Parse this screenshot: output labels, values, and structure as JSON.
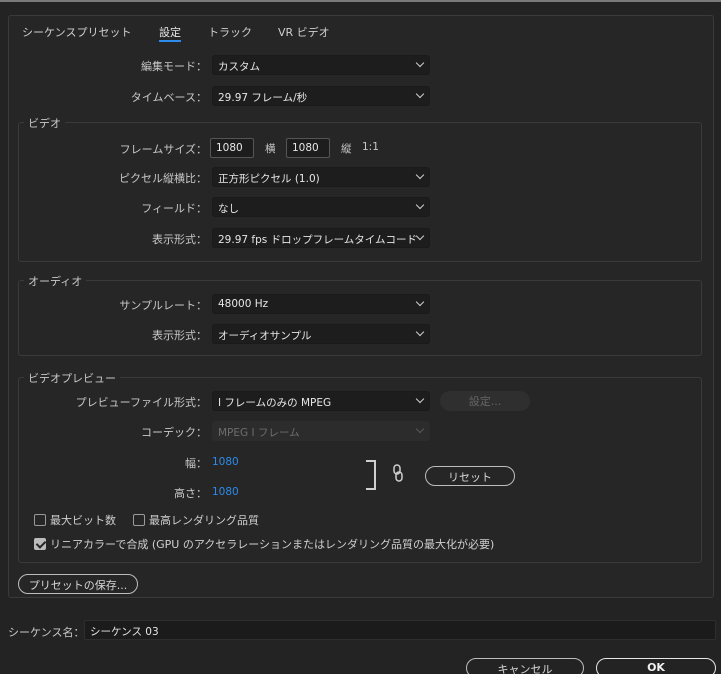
{
  "tabs": [
    {
      "label": "シーケンスプリセット",
      "active": false
    },
    {
      "label": "設定",
      "active": true
    },
    {
      "label": "トラック",
      "active": false
    },
    {
      "label": "VR ビデオ",
      "active": false
    }
  ],
  "edit_mode": {
    "label": "編集モード：",
    "value": "カスタム"
  },
  "timebase": {
    "label": "タイムベース：",
    "value": "29.97  フレーム/秒"
  },
  "video": {
    "title": "ビデオ",
    "frame_size": {
      "label": "フレームサイズ：",
      "width": "1080",
      "h_label": "横",
      "height": "1080",
      "v_label": "縦",
      "ratio": "1:1"
    },
    "pixel_aspect": {
      "label": "ピクセル縦横比：",
      "value": "正方形ピクセル (1.0)"
    },
    "fields": {
      "label": "フィールド：",
      "value": "なし"
    },
    "display_format": {
      "label": "表示形式：",
      "value": "29.97 fps ドロップフレームタイムコード"
    }
  },
  "audio": {
    "title": "オーディオ",
    "sample_rate": {
      "label": "サンプルレート：",
      "value": "48000 Hz"
    },
    "display_format": {
      "label": "表示形式：",
      "value": "オーディオサンプル"
    }
  },
  "video_preview": {
    "title": "ビデオプレビュー",
    "preview_format": {
      "label": "プレビューファイル形式：",
      "value": "I フレームのみの MPEG"
    },
    "settings_button": "設定...",
    "codec": {
      "label": "コーデック：",
      "value": "MPEG I フレーム"
    },
    "width": {
      "label": "幅：",
      "value": "1080"
    },
    "height": {
      "label": "高さ：",
      "value": "1080"
    },
    "reset_button": "リセット",
    "max_bit_depth": {
      "label": "最大ビット数",
      "checked": false
    },
    "max_render_quality": {
      "label": "最高レンダリング品質",
      "checked": false
    },
    "linear_color": {
      "label": "リニアカラーで合成 (GPU のアクセラレーションまたはレンダリング品質の最大化が必要)",
      "checked": true
    }
  },
  "save_preset_button": "プリセットの保存...",
  "sequence_name": {
    "label": "シーケンス名：",
    "value": "シーケンス 03"
  },
  "cancel_button": "キャンセル",
  "ok_button": "OK",
  "colors": {
    "accent": "#2d8ceb",
    "background": "#232323"
  }
}
